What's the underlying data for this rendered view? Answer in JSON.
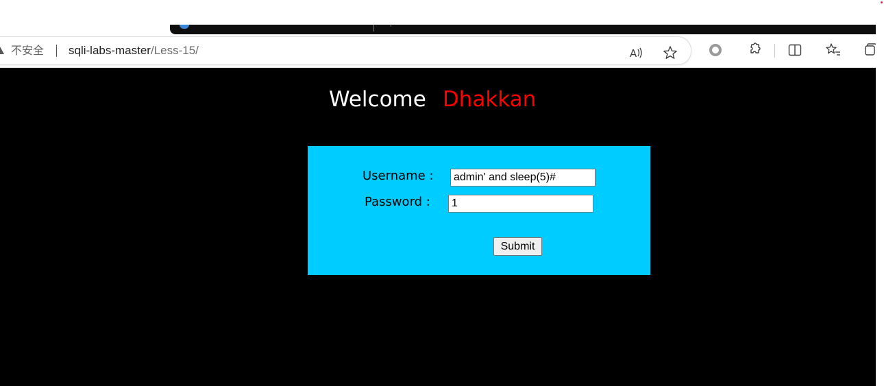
{
  "browser": {
    "security_label": "不安全",
    "url_host": "sqli-labs-master",
    "url_path": "/Less-15/",
    "toolbar_icons": [
      "read-aloud-icon",
      "favorite-star-icon",
      "circle-record-icon",
      "extensions-icon",
      "split-screen-icon",
      "favorites-icon",
      "collections-icon"
    ]
  },
  "page": {
    "welcome_word": "Welcome",
    "welcome_name": "Dhakkan",
    "colors": {
      "background": "#000000",
      "box": "#00ccff",
      "name": "#ff0000"
    }
  },
  "form": {
    "username_label": "Username :",
    "username_value": "admin' and sleep(5)#",
    "password_label": "Password :",
    "password_value": "1",
    "submit_label": "Submit"
  }
}
